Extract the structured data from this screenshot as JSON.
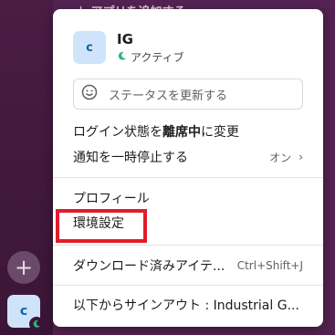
{
  "workspace": {
    "top_item": "アプリを追加する"
  },
  "sidebar": {
    "add_icon": "plus-icon",
    "avatar_initial": "c"
  },
  "menu": {
    "profile": {
      "initial": "c",
      "name": "IG",
      "status": "アクティブ"
    },
    "status_input_placeholder": "ステータスを更新する",
    "away_prefix": "ログイン状態を",
    "away_bold": "離席中",
    "away_suffix": "に変更",
    "pause_notifications": {
      "label": "通知を一時停止する",
      "value": "オン"
    },
    "profile_item": "プロフィール",
    "preferences_item": "環境設定",
    "downloads_item": {
      "label": "ダウンロード済みアイテ...",
      "shortcut": "Ctrl+Shift+J"
    },
    "sign_out_item": "以下からサインアウト : Industrial G..."
  },
  "colors": {
    "sidebar": "#3f1a3c",
    "avatar_bg": "#cfe3fb",
    "highlight": "#e01e2a"
  }
}
